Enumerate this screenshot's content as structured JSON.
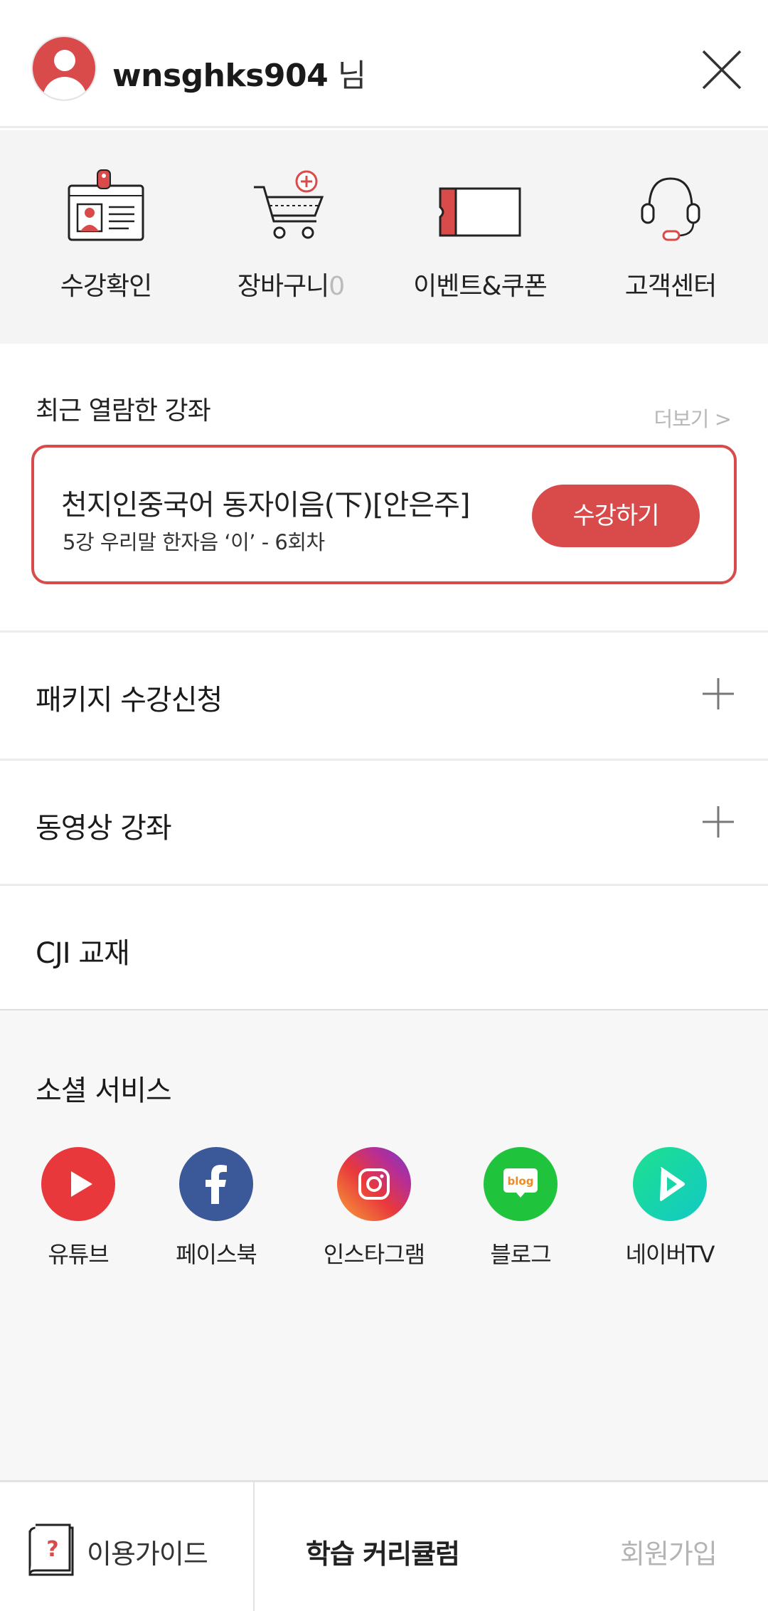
{
  "header": {
    "username": "wnsghks904",
    "username_suffix": " 님"
  },
  "quick_menu": [
    {
      "label": "수강확인",
      "icon": "id-card-icon"
    },
    {
      "label": "장바구니",
      "count": "0",
      "icon": "cart-icon"
    },
    {
      "label": "이벤트&쿠폰",
      "icon": "ticket-icon"
    },
    {
      "label": "고객센터",
      "icon": "headset-icon"
    }
  ],
  "recent": {
    "title": "최근 열람한 강좌",
    "more": "더보기 >",
    "course_title": "천지인중국어 동자이음(下)[안은주]",
    "course_subtitle": "5강 우리말 한자음 ‘이’ - 6회차",
    "button": "수강하기"
  },
  "menu": [
    {
      "label": "패키지 수강신청",
      "expandable": true
    },
    {
      "label": "동영상 강좌",
      "expandable": true
    },
    {
      "label": "CJI 교재",
      "expandable": false
    }
  ],
  "social": {
    "title": "소셜 서비스",
    "items": [
      {
        "label": "유튜브",
        "icon": "youtube-icon",
        "color": "#e8383b"
      },
      {
        "label": "페이스북",
        "icon": "facebook-icon",
        "color": "#3b5998"
      },
      {
        "label": "인스타그램",
        "icon": "instagram-icon",
        "color": "#c13584"
      },
      {
        "label": "블로그",
        "icon": "blog-icon",
        "color": "#20c33c",
        "badge": "blog"
      },
      {
        "label": "네이버TV",
        "icon": "naver-tv-icon",
        "color": "#17d6a8"
      }
    ]
  },
  "bottom_bar": {
    "guide": "이용가이드",
    "curriculum": "학습 커리큘럼",
    "signup": "회원가입"
  },
  "colors": {
    "accent": "#d94a4a",
    "muted": "#bbbbbb"
  }
}
